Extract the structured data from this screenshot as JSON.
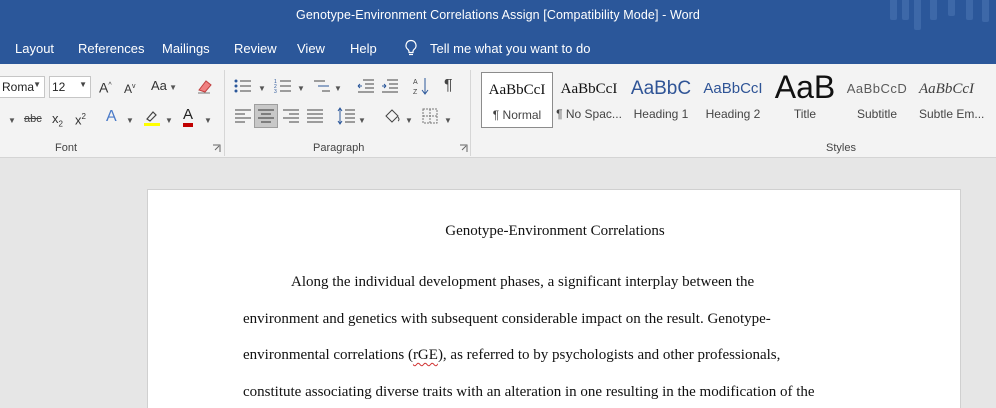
{
  "window": {
    "title": "Genotype-Environment Correlations Assign [Compatibility Mode]  -  Word"
  },
  "menu": {
    "items": [
      "Layout",
      "References",
      "Mailings",
      "Review",
      "View",
      "Help"
    ],
    "tell_me": "Tell me what you want to do"
  },
  "ribbon": {
    "font": {
      "name": "Roma",
      "size": "12",
      "grow": "A",
      "shrink": "A",
      "change_case": "Aa",
      "strike": "abc",
      "subscript": "x",
      "subscript_sub": "2",
      "superscript": "x",
      "superscript_sup": "2",
      "effects": "A",
      "color_letter": "A",
      "group_label": "Font",
      "highlight_color": "#ffff00",
      "font_color": "#c00000"
    },
    "paragraph": {
      "group_label": "Paragraph",
      "selected_alignment": "center"
    },
    "styles": {
      "group_label": "Styles",
      "items": [
        {
          "sample": "AaBbCcI",
          "name": "¶ Normal"
        },
        {
          "sample": "AaBbCcI",
          "name": "¶ No Spac..."
        },
        {
          "sample": "AaBbC",
          "name": "Heading 1"
        },
        {
          "sample": "AaBbCcI",
          "name": "Heading 2"
        },
        {
          "sample": "AaB",
          "name": "Title"
        },
        {
          "sample": "AaBbCcD",
          "name": "Subtitle"
        },
        {
          "sample": "AaBbCcI",
          "name": "Subtle Em..."
        }
      ]
    }
  },
  "document": {
    "title": "Genotype-Environment Correlations",
    "lines": [
      "Along the individual development phases, a significant interplay between the",
      "environment and genetics with subsequent considerable impact on the result. Genotype-",
      "environmental correlations (",
      "rGE",
      "), as referred to by psychologists and other professionals,",
      "constitute associating diverse traits with an alteration in one resulting in the modification of the"
    ]
  },
  "colors": {
    "accent": "#2b579a",
    "ribbon_bg": "#f3f3f3",
    "canvas_bg": "#e6e6e6"
  }
}
